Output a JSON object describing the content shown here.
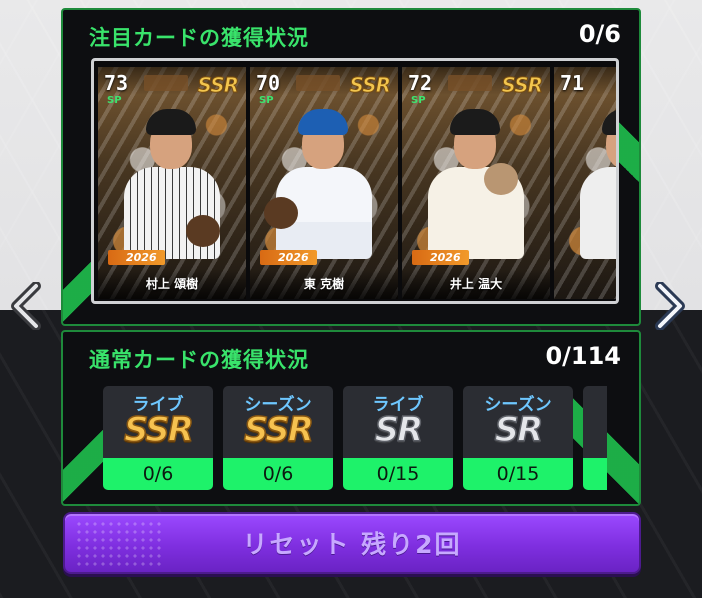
{
  "featured": {
    "title": "注目カードの獲得状況",
    "count": "0/6",
    "cards": [
      {
        "ovr": "73",
        "pos": "SP",
        "rarity": "SSR",
        "year": "2026",
        "name": "村上 頌樹",
        "cap_color": "#1a1a1a",
        "uniform_color": "#f2f2f2"
      },
      {
        "ovr": "70",
        "pos": "SP",
        "rarity": "SSR",
        "year": "2026",
        "name": "東 克樹",
        "cap_color": "#1d5fb3",
        "uniform_color": "#f4f6fa"
      },
      {
        "ovr": "72",
        "pos": "SP",
        "rarity": "SSR",
        "year": "2026",
        "name": "井上 温大",
        "cap_color": "#1b1b1b",
        "uniform_color": "#f6f1e6"
      },
      {
        "ovr": "71",
        "pos": "",
        "rarity": "",
        "year": "",
        "name": "",
        "cap_color": "#1b1b1b",
        "uniform_color": "#eee"
      }
    ]
  },
  "normal": {
    "title": "通常カードの獲得状況",
    "count": "0/114",
    "tiles": [
      {
        "label": "ライブ",
        "rarity": "SSR",
        "progress": "0/6"
      },
      {
        "label": "シーズン",
        "rarity": "SSR",
        "progress": "0/6"
      },
      {
        "label": "ライブ",
        "rarity": "SR",
        "progress": "0/15"
      },
      {
        "label": "シーズン",
        "rarity": "SR",
        "progress": "0/15"
      }
    ]
  },
  "reset_button": {
    "label": "リセット 残り2回"
  },
  "colors": {
    "accent_green": "#39e36b",
    "progress_green": "#1ef26a",
    "button_purple": "#8a3cf0",
    "tile_label_blue": "#6ec7ff"
  }
}
